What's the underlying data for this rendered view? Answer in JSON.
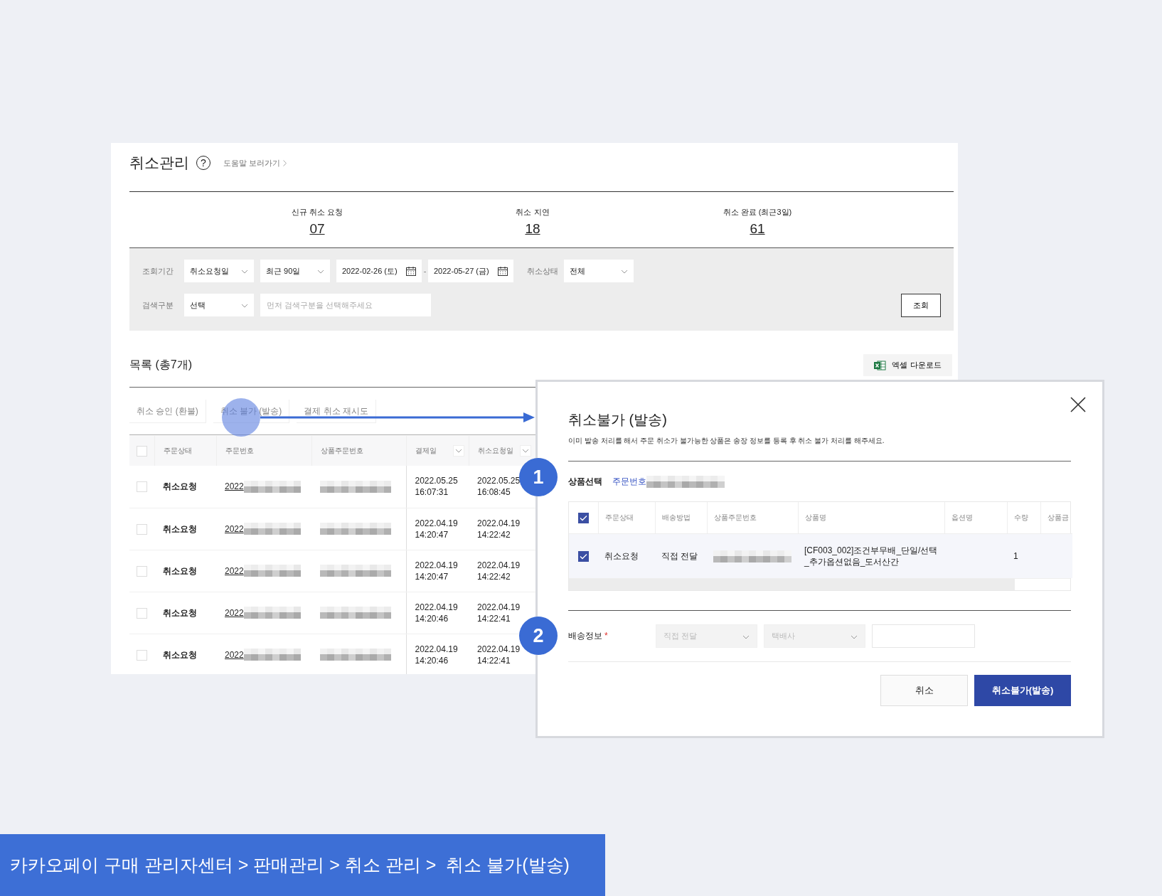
{
  "header": {
    "title": "취소관리",
    "help_icon": "?",
    "help_link": "도움말 보러가기"
  },
  "stats": [
    {
      "label": "신규 취소 요청",
      "value": "07"
    },
    {
      "label": "취소 지연",
      "value": "18"
    },
    {
      "label": "취소 완료 (최근3일)",
      "value": "61"
    }
  ],
  "filters": {
    "period_label": "조회기간",
    "date_type": "취소요청일",
    "range": "최근 90일",
    "start_date": "2022-02-26 (토)",
    "separator": "-",
    "end_date": "2022-05-27 (금)",
    "status_label": "취소상태",
    "status": "전체",
    "search_label": "검색구분",
    "search_type": "선택",
    "search_placeholder": "먼저 검색구분을 선택해주세요",
    "search_button": "조회"
  },
  "list": {
    "title": "목록 (총7개)",
    "excel_button": "엑셀 다운로드",
    "actions": [
      "취소 승인 (환불)",
      "취소 불가 (발송)",
      "결제 취소 재시도"
    ],
    "table": {
      "header_checked": false,
      "columns": [
        {
          "label": "주문상태",
          "sortable": false
        },
        {
          "label": "주문번호",
          "sortable": false
        },
        {
          "label": "상품주문번호",
          "sortable": false
        },
        {
          "label": "결제일",
          "sortable": true
        },
        {
          "label": "취소요청일",
          "sortable": true
        }
      ],
      "rows": [
        {
          "checked": false,
          "status": "취소요청",
          "order_no": "2022",
          "paid_at": "2022.05.25\n16:07:31",
          "requested_at": "2022.05.25\n16:08:45"
        },
        {
          "checked": false,
          "status": "취소요청",
          "order_no": "2022",
          "paid_at": "2022.04.19\n14:20:47",
          "requested_at": "2022.04.19\n14:22:42"
        },
        {
          "checked": false,
          "status": "취소요청",
          "order_no": "2022",
          "paid_at": "2022.04.19\n14:20:47",
          "requested_at": "2022.04.19\n14:22:42"
        },
        {
          "checked": false,
          "status": "취소요청",
          "order_no": "2022",
          "paid_at": "2022.04.19\n14:20:46",
          "requested_at": "2022.04.19\n14:22:41"
        },
        {
          "checked": false,
          "status": "취소요청",
          "order_no": "2022",
          "paid_at": "2022.04.19\n14:20:46",
          "requested_at": "2022.04.19\n14:22:41"
        }
      ]
    }
  },
  "modal": {
    "title": "취소불가 (발송)",
    "description": "이미 발송 처리를 해서 주문 취소가 불가능한 상품은 송장 정보를 등록 후 취소 불가 처리를 해주세요.",
    "product_label": "상품선택",
    "order_label": "주문번호",
    "table": {
      "header_checked": true,
      "columns": [
        "주문상태",
        "배송방법",
        "상품주문번호",
        "상품명",
        "옵션명",
        "수량",
        "상품금"
      ],
      "rows": [
        {
          "checked": true,
          "status": "취소요청",
          "method": "직접 전달",
          "product_name": "[CF003_002]조건부무배_단일/선택\n_추가옵션없음_도서산간",
          "quantity": "1"
        }
      ]
    },
    "delivery": {
      "label": "배송정보",
      "required_mark": "*",
      "method": {
        "value": "직접 전달",
        "disabled": true
      },
      "courier": {
        "placeholder": "택배사",
        "disabled": true
      }
    },
    "buttons": [
      {
        "label": "취소",
        "kind": "secondary"
      },
      {
        "label": "취소불가(발송)",
        "kind": "primary"
      }
    ]
  },
  "steps": [
    "1",
    "2"
  ],
  "breadcrumb": "카카오페이 구매 관리자센터 > 판매관리 > 취소 관리 >  취소 불가(발송)"
}
